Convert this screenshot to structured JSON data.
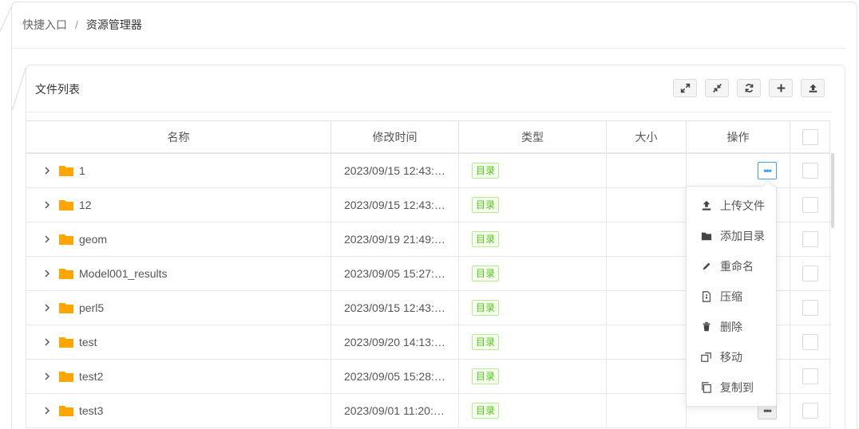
{
  "breadcrumb": {
    "root": "快捷入口",
    "separator": "/",
    "current": "资源管理器"
  },
  "panel": {
    "title": "文件列表"
  },
  "toolbar": [
    {
      "icon": "expand-icon"
    },
    {
      "icon": "collapse-icon"
    },
    {
      "icon": "refresh-icon"
    },
    {
      "icon": "plus-icon"
    },
    {
      "icon": "upload-icon"
    }
  ],
  "table": {
    "headers": {
      "name": "名称",
      "time": "修改时间",
      "type": "类型",
      "size": "大小",
      "ops": "操作"
    },
    "rows": [
      {
        "name": "1",
        "time": "2023/09/15 12:43:…",
        "type": "目录",
        "size": ""
      },
      {
        "name": "12",
        "time": "2023/09/15 12:43:…",
        "type": "目录",
        "size": ""
      },
      {
        "name": "geom",
        "time": "2023/09/19 21:49:…",
        "type": "目录",
        "size": ""
      },
      {
        "name": "Model001_results",
        "time": "2023/09/05 15:27:…",
        "type": "目录",
        "size": ""
      },
      {
        "name": "perl5",
        "time": "2023/09/15 12:43:…",
        "type": "目录",
        "size": ""
      },
      {
        "name": "test",
        "time": "2023/09/20 14:13:…",
        "type": "目录",
        "size": ""
      },
      {
        "name": "test2",
        "time": "2023/09/05 15:28:…",
        "type": "目录",
        "size": ""
      },
      {
        "name": "test3",
        "time": "2023/09/01 11:20:…",
        "type": "目录",
        "size": ""
      }
    ]
  },
  "dropdown": {
    "items": [
      {
        "label": "上传文件",
        "icon": "upload-icon"
      },
      {
        "label": "添加目录",
        "icon": "folder-icon"
      },
      {
        "label": "重命名",
        "icon": "pencil-icon"
      },
      {
        "label": "压缩",
        "icon": "zip-file-icon"
      },
      {
        "label": "删除",
        "icon": "trash-icon"
      },
      {
        "label": "移动",
        "icon": "move-icon"
      },
      {
        "label": "复制到",
        "icon": "copy-icon"
      }
    ]
  },
  "colors": {
    "folder": "#ffa500",
    "tag_green": "#52c41a",
    "accent": "#409eff"
  }
}
